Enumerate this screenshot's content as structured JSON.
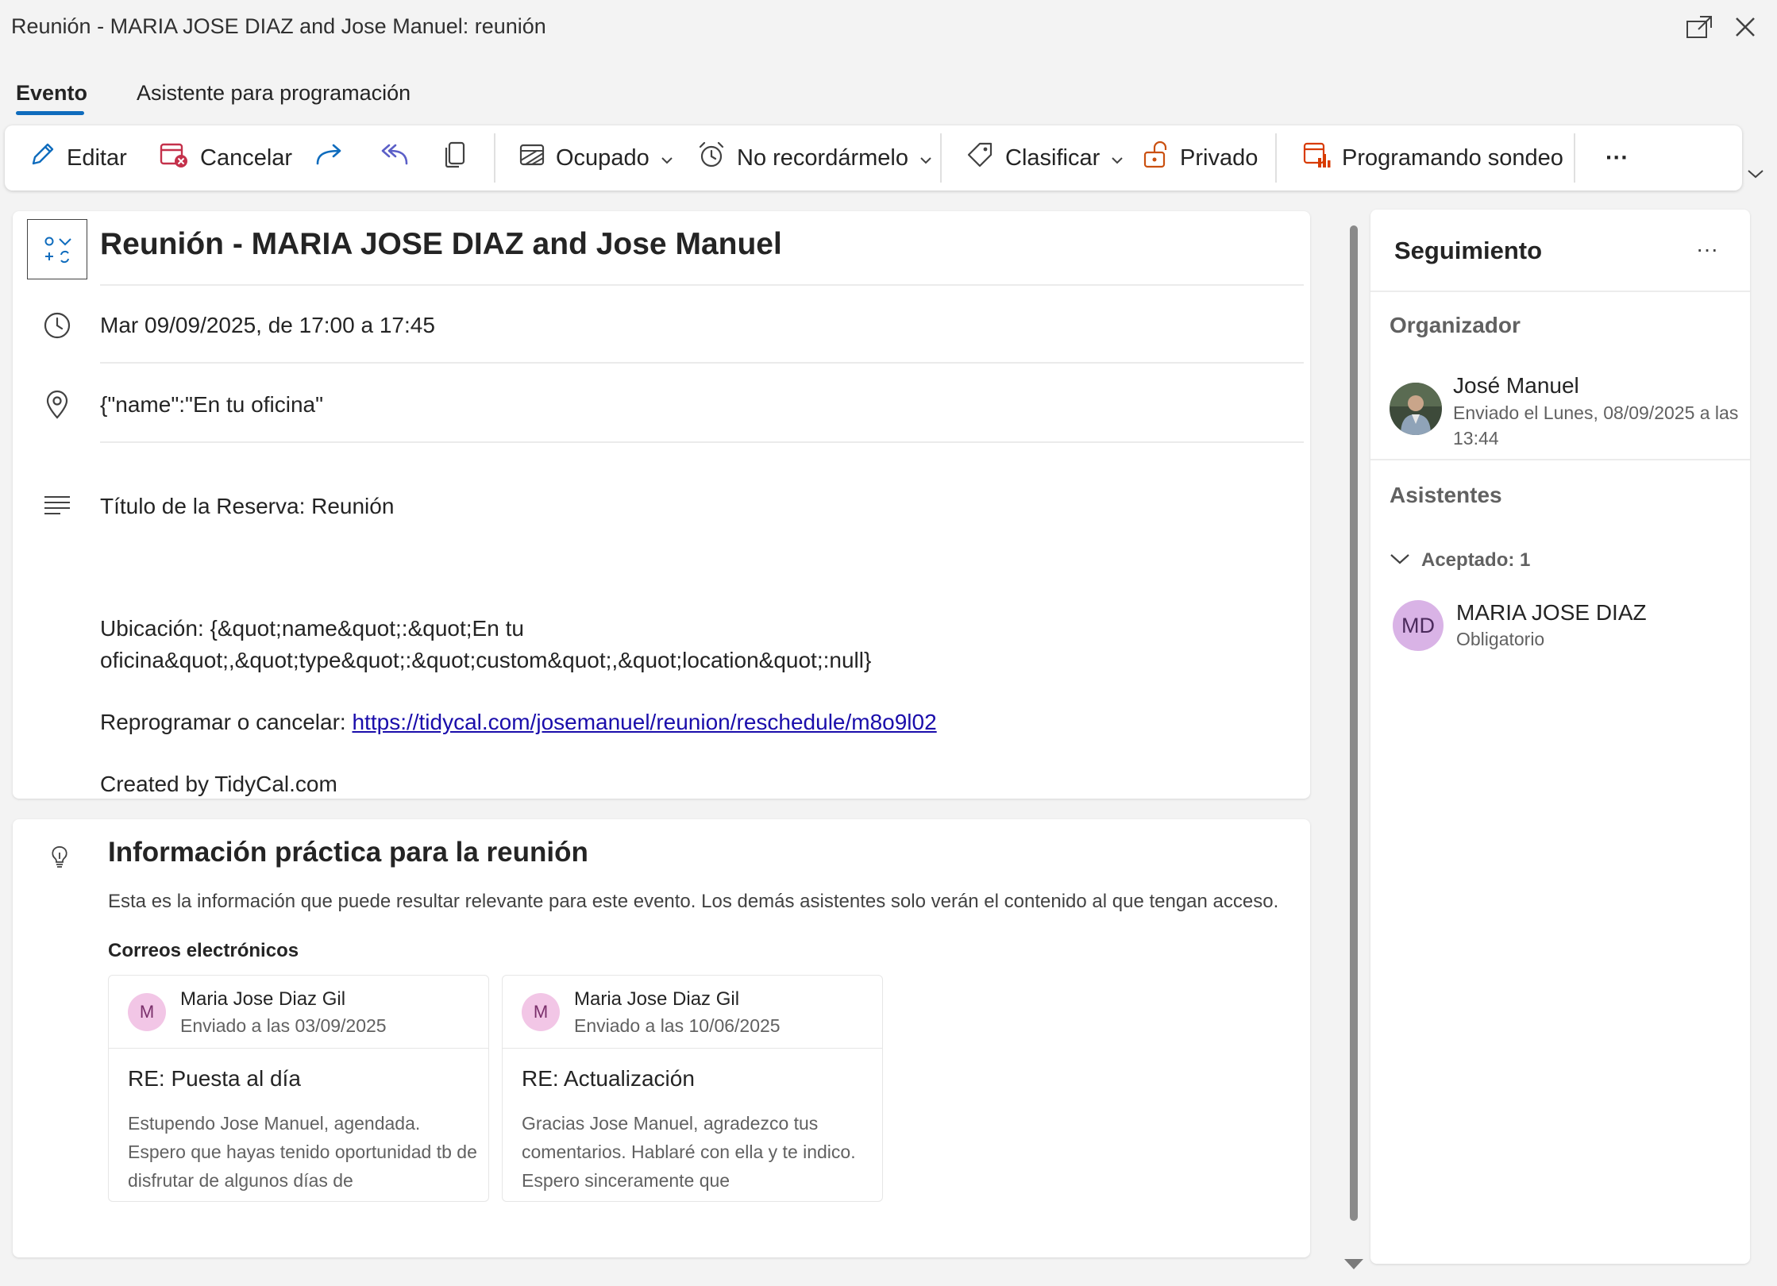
{
  "window": {
    "title": "Reunión - MARIA JOSE DIAZ and Jose Manuel: reunión"
  },
  "tabs": [
    {
      "label": "Evento",
      "active": true
    },
    {
      "label": "Asistente para programación",
      "active": false
    }
  ],
  "toolbar": {
    "edit_label": "Editar",
    "cancel_label": "Cancelar",
    "busy_label": "Ocupado",
    "reminder_label": "No recordármelo",
    "classify_label": "Clasificar",
    "private_label": "Privado",
    "poll_label": "Programando sondeo",
    "more_label": "···"
  },
  "event": {
    "subject": "Reunión - MARIA JOSE DIAZ and Jose Manuel",
    "datetime": "Mar 09/09/2025, de 17:00 a 17:45",
    "location": "{\"name\":\"En tu oficina\"",
    "body": {
      "booking_title": "Título de la Reserva: Reunión",
      "location_line1": "Ubicación: {&quot;name&quot;:&quot;En tu",
      "location_line2": "oficina&quot;,&quot;type&quot;:&quot;custom&quot;,&quot;location&quot;:null}",
      "reschedule_prefix": "Reprogramar o cancelar: ",
      "reschedule_link": "https://tidycal.com/josemanuel/reunion/reschedule/m8o9l02",
      "created_by": "Created by TidyCal.com"
    }
  },
  "insights": {
    "title": "Información práctica para la reunión",
    "description": "Esta es la información que puede resultar relevante para este evento. Los demás asistentes solo verán el contenido al que tengan acceso.",
    "emails_heading": "Correos electrónicos",
    "emails": [
      {
        "initial": "M",
        "from": "Maria Jose Diaz Gil",
        "date": "Enviado a las 03/09/2025",
        "subject": "RE: Puesta al día",
        "preview": "Estupendo Jose Manuel, agendada. Espero que hayas tenido oportunidad tb de disfrutar de algunos días de"
      },
      {
        "initial": "M",
        "from": "Maria Jose Diaz Gil",
        "date": "Enviado a las 10/06/2025",
        "subject": "RE: Actualización",
        "preview": "Gracias Jose Manuel, agradezco tus comentarios. Hablaré con ella y te indico. Espero sinceramente que"
      }
    ]
  },
  "tracking": {
    "title": "Seguimiento",
    "more_label": "···",
    "organizer_heading": "Organizador",
    "organizer": {
      "name": "José Manuel",
      "sent": "Enviado el Lunes, 08/09/2025 a las 13:44"
    },
    "attendees_heading": "Asistentes",
    "accepted_label": "Aceptado: 1",
    "attendees": [
      {
        "initials": "MD",
        "name": "MARIA JOSE DIAZ",
        "role": "Obligatorio"
      }
    ]
  },
  "colors": {
    "accent": "#0f6cbd",
    "cancel_red": "#c4314b",
    "reply_purple": "#5b5fc7",
    "poll_orange": "#d83b01",
    "link": "#1a0dab"
  },
  "icons": [
    "expand-window-icon",
    "close-icon",
    "pencil-icon",
    "calendar-cancel-icon",
    "forward-arrow-icon",
    "reply-all-icon",
    "copy-icon",
    "busy-status-icon",
    "alarm-clock-icon",
    "tag-icon",
    "unlock-icon",
    "poll-chart-icon",
    "clock-icon",
    "location-pin-icon",
    "text-lines-icon",
    "lightbulb-icon",
    "chevron-down-icon"
  ]
}
